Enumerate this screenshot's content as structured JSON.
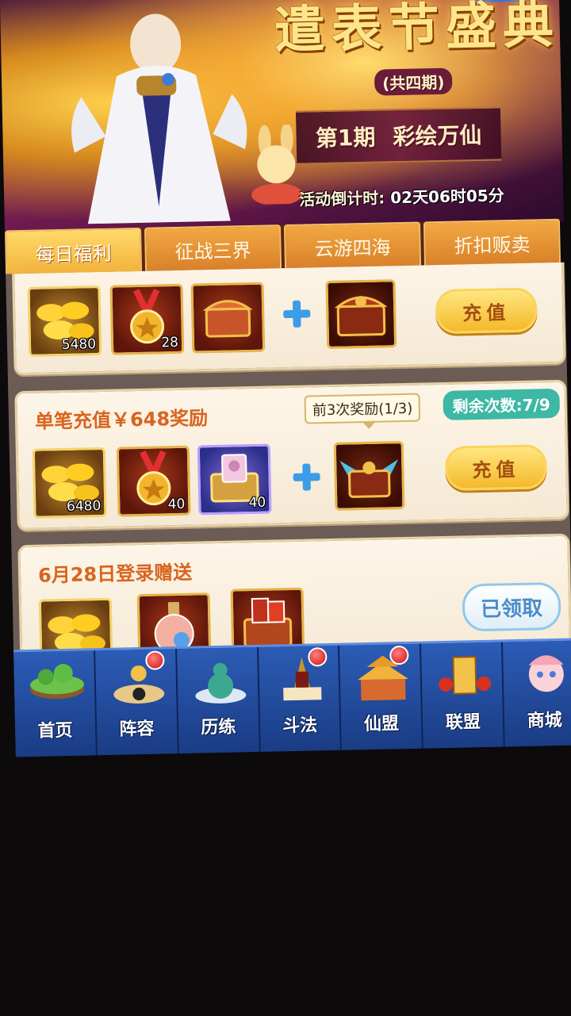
{
  "banner": {
    "title_art": "遣表节盛典",
    "subtitle": "(共四期)",
    "period_number": "第1期",
    "period_name": "彩绘万仙",
    "countdown_label": "活动倒计时:",
    "countdown_value": "02天06时05分"
  },
  "tabs": [
    {
      "label": "每日福利",
      "active": true
    },
    {
      "label": "征战三界",
      "active": false
    },
    {
      "label": "云游四海",
      "active": false
    },
    {
      "label": "折扣贩卖",
      "active": false
    }
  ],
  "cards": {
    "first": {
      "items": [
        {
          "icon": "gold-ingots-icon",
          "count": "5480"
        },
        {
          "icon": "medal-icon",
          "count": "28"
        },
        {
          "icon": "treasure-chest-icon",
          "count": ""
        }
      ],
      "bonus_icon": "ornate-chest-icon",
      "button": "充值"
    },
    "second": {
      "title": "单笔充值￥648奖励",
      "remaining": "剩余次数:7/9",
      "tooltip": "前3次奖励(1/3)",
      "items": [
        {
          "icon": "gold-ingots-icon",
          "count": "6480"
        },
        {
          "icon": "medal-icon",
          "count": "40"
        },
        {
          "icon": "portrait-chest-icon",
          "count": "40"
        }
      ],
      "bonus_icon": "winged-chest-icon",
      "button": "充值"
    },
    "third": {
      "title": "6月28日登录赠送",
      "items": [
        {
          "icon": "gold-ingots-icon"
        },
        {
          "icon": "potion-bottle-icon"
        },
        {
          "icon": "scroll-chest-icon"
        }
      ],
      "button": "已领取"
    }
  },
  "nav": [
    {
      "label": "首页",
      "icon": "floating-island-icon",
      "dot": false
    },
    {
      "label": "阵容",
      "icon": "formation-icon",
      "dot": true
    },
    {
      "label": "历练",
      "icon": "gourd-icon",
      "dot": false
    },
    {
      "label": "斗法",
      "icon": "helmet-icon",
      "dot": true
    },
    {
      "label": "仙盟",
      "icon": "palace-icon",
      "dot": true
    },
    {
      "label": "联盟",
      "icon": "alliance-banner-icon",
      "dot": false
    },
    {
      "label": "商城",
      "icon": "shop-girl-icon",
      "dot": false
    }
  ],
  "colors": {
    "tab_active": "#ffda6b",
    "card_title": "#d8641e",
    "nav_bg": "#224b9b",
    "remaining_badge": "#3cb8a5"
  }
}
